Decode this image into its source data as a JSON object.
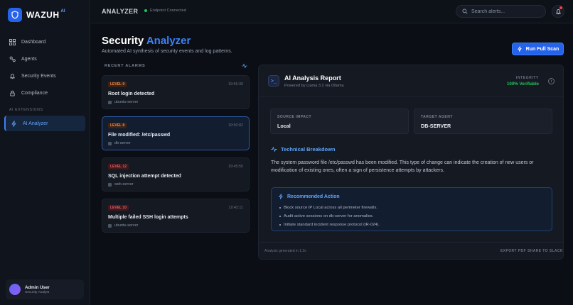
{
  "brand": {
    "name": "WAZUH",
    "tag": "AI"
  },
  "sidebar": {
    "items": [
      {
        "label": "Dashboard",
        "icon": "grid-icon"
      },
      {
        "label": "Agents",
        "icon": "agents-icon"
      },
      {
        "label": "Security Events",
        "icon": "bell-icon"
      },
      {
        "label": "Compliance",
        "icon": "lock-icon"
      }
    ],
    "section_label": "AI EXTENSIONS",
    "ai_item": {
      "label": "AI Analyzer",
      "icon": "bolt-icon"
    }
  },
  "user": {
    "name": "Admin User",
    "role": "Security Analyst"
  },
  "topbar": {
    "title": "ANALYZER",
    "status": "Endpoint Connected",
    "search_placeholder": "Search alerts..."
  },
  "header": {
    "title_part1": "Security",
    "title_part2": "Analyzer",
    "subtitle": "Automated AI synthesis of security events and log patterns.",
    "run_button": "Run Full Scan"
  },
  "alarms": {
    "heading": "RECENT ALARMS",
    "items": [
      {
        "level": "LEVEL 9",
        "time": "19:55:30",
        "title": "Root login detected",
        "host": "ubuntu-server"
      },
      {
        "level": "LEVEL 8",
        "time": "19:50:02",
        "title": "File modified: /etc/passwd",
        "host": "db-server"
      },
      {
        "level": "LEVEL 12",
        "time": "19:45:55",
        "title": "SQL injection attempt detected",
        "host": "web-server"
      },
      {
        "level": "LEVEL 10",
        "time": "19:42:11",
        "title": "Multiple failed SSH login attempts",
        "host": "ubuntu-server"
      }
    ]
  },
  "report": {
    "title": "AI Analysis Report",
    "subtitle": "Powered by Llama 3.2 via Ollama",
    "integrity_label": "INTEGRITY",
    "integrity_value": "100% Verifiable",
    "source_label": "SOURCE IMPACT",
    "source_value": "Local",
    "target_label": "TARGET AGENT",
    "target_value": "DB-SERVER",
    "breakdown_title": "Technical Breakdown",
    "breakdown_text": "The system password file /etc/passwd has been modified. This type of change can indicate the creation of new users or modification of existing ones, often a sign of persistence attempts by attackers.",
    "action_title": "Recommended Action",
    "actions": [
      "Block source IP Local across all perimeter firewalls.",
      "Audit active sessions on db-server for anomalies.",
      "Initiate standard incident response protocol (IR-024)."
    ],
    "footer_note": "Analysis generated in 1.2s",
    "export_label": "EXPORT PDF",
    "share_label": "SHARE TO SLACK"
  },
  "colors": {
    "accent": "#3b82f6",
    "success": "#22c55e",
    "level_orange": "#f0894b",
    "level_red": "#f2545b"
  }
}
